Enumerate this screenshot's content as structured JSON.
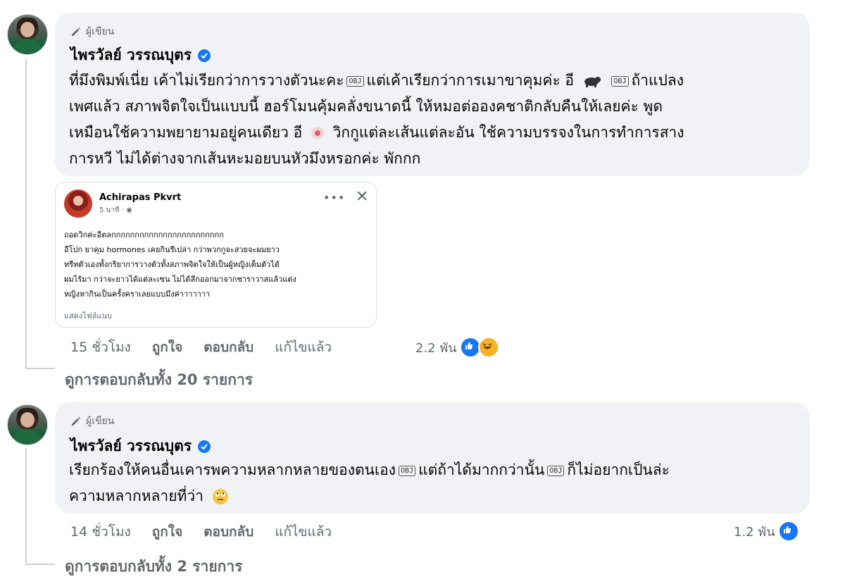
{
  "comments": [
    {
      "author_tag": "ผู้เขียน",
      "name": "ไพรวัลย์ วรรณบุตร",
      "lines": [
        [
          "ที่มึงพิมพ์เนี่ย เค้าไม่เรียกว่าการวางตัวนะคะ",
          "OBJ",
          "แต่เค้าเรียกว่าการเมาขาคุมค่ะ อี",
          "BULL",
          "OBJ",
          "ถ้าแปลง"
        ],
        [
          "เพศแล้ว สภาพจิตใจเป็นแบบนี้ ฮอร์โมนคุ้มคลั่งขนาดนี้ ให้หมอต่อองคชาติกลับคืนให้เลยค่ะ พูด"
        ],
        [
          "เหมือนใช้ความพยายามอยู่คนเดียว อี",
          "FLOWER",
          "วิกกูแต่ละเส้นแต่ละอัน ใช้ความบรรจงในการทำการสาง"
        ],
        [
          "การหวี ไม่ได้ต่างจากเส้นหะมอยบนหัวมึงหรอกค่ะ พักกก"
        ]
      ],
      "actions": {
        "time": "15 ชั่วโมง",
        "like": "ถูกใจ",
        "reply": "ตอบกลับ",
        "edited": "แก้ไขแล้ว"
      },
      "reaction_count": "2.2 พัน",
      "view_replies": "ดูการตอบกลับทั้ง 20 รายการ"
    },
    {
      "author_tag": "ผู้เขียน",
      "name": "ไพรวัลย์ วรรณบุตร",
      "lines": [
        [
          "เรียกร้องให้คนอื่นเคารพความหลากหลายของตนเอง",
          "OBJ",
          "แต่ถ้าได้มากกว่านั้น",
          "OBJ",
          "ก็ไม่อยากเป็นล่ะ"
        ],
        [
          "ความหลากหลายที่ว่า",
          "ROLLEYES"
        ]
      ],
      "actions": {
        "time": "14 ชั่วโมง",
        "like": "ถูกใจ",
        "reply": "ตอบกลับ",
        "edited": "แก้ไขแล้ว"
      },
      "reaction_count": "1.2 พัน",
      "view_replies": "ดูการตอบกลับทั้ง 2 รายการ"
    }
  ],
  "shared_post": {
    "name": "Achirapas Pkvrt",
    "time": "5 นาที · ",
    "lines": [
      "ถอดวิกค่ะอีตลกกกกกกกกกกกกกกกกกกกกกกกก",
      "อีโปก ยาคุม hormones เคยกินรึเปล่า กว่าพวกกูจะสวยจะผมยาว",
      "ทรีทตัวเองทั้งกริยาการวางตัวทั้งสภาพจิตใจให้เป็นผู้หญิงเต็มตัวได้",
      "ผมไร้มา กว่าจะยาวได้แต่ละเซน ไม่ได้ลึกออกมาจากชาราวาสแล้วแต่ง",
      "หญิงหากินเป็นครั้งคราเลยแบบมึงค่าาาาาาา"
    ],
    "more": "แสดงไฟล์แนบ"
  },
  "emoji_box_text": "OBJ"
}
